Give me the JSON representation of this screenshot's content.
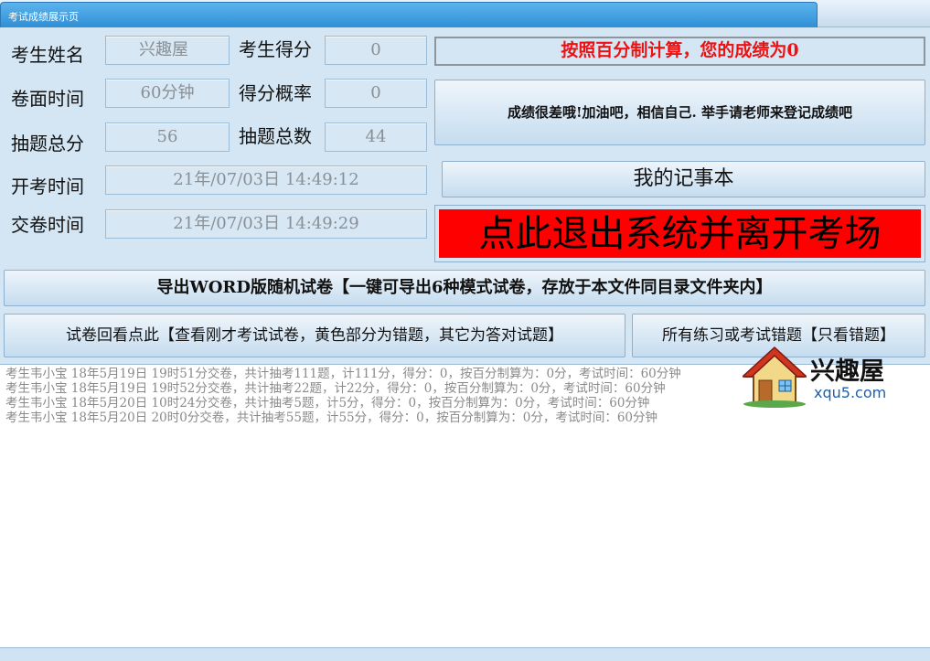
{
  "window": {
    "title": "考试成绩展示页"
  },
  "form": {
    "name_label": "考生姓名",
    "name_value": "兴趣屋",
    "score_label": "考生得分",
    "score_value": "0",
    "duration_label": "卷面时间",
    "duration_value": "60分钟",
    "rate_label": "得分概率",
    "rate_value": "0",
    "total_points_label": "抽题总分",
    "total_points_value": "56",
    "total_count_label": "抽题总数",
    "total_count_value": "44",
    "start_label": "开考时间",
    "start_value": "21年/07/03日    14:49:12",
    "submit_label": "交卷时间",
    "submit_value": "21年/07/03日    14:49:29"
  },
  "result": {
    "percent_text": "按照百分制计算，您的成绩为0",
    "comment_text": "成绩很差哦!加油吧，相信自己. 举手请老师来登记成绩吧"
  },
  "buttons": {
    "notebook": "我的记事本",
    "exit": "点此退出系统并离开考场",
    "export_word": "导出WORD版随机试卷【一键可导出6种模式试卷，存放于本文件同目录文件夹内】",
    "review": "试卷回看点此【查看刚才考试试卷，黄色部分为错题，其它为答对试题】",
    "wrong_only": "所有练习或考试错题【只看错题】"
  },
  "log": [
    "考生韦小宝 18年5月19日 19时51分交卷，共计抽考111题，计111分，得分：0，按百分制算为：0分，考试时间：60分钟",
    "考生韦小宝 18年5月19日 19时52分交卷，共计抽考22题，计22分，得分：0，按百分制算为：0分，考试时间：60分钟",
    "考生韦小宝 18年5月20日 10时24分交卷，共计抽考5题，计5分，得分：0，按百分制算为：0分，考试时间：60分钟",
    "考生韦小宝 18年5月20日 20时0分交卷，共计抽考55题，计55分，得分：0，按百分制算为：0分，考试时间：60分钟"
  ],
  "logo": {
    "cn": "兴趣屋",
    "en": "xqu5.com"
  },
  "colors": {
    "accent": "#ff0000",
    "score_text": "#ee1111",
    "title_tab": "#3a9ae0"
  }
}
